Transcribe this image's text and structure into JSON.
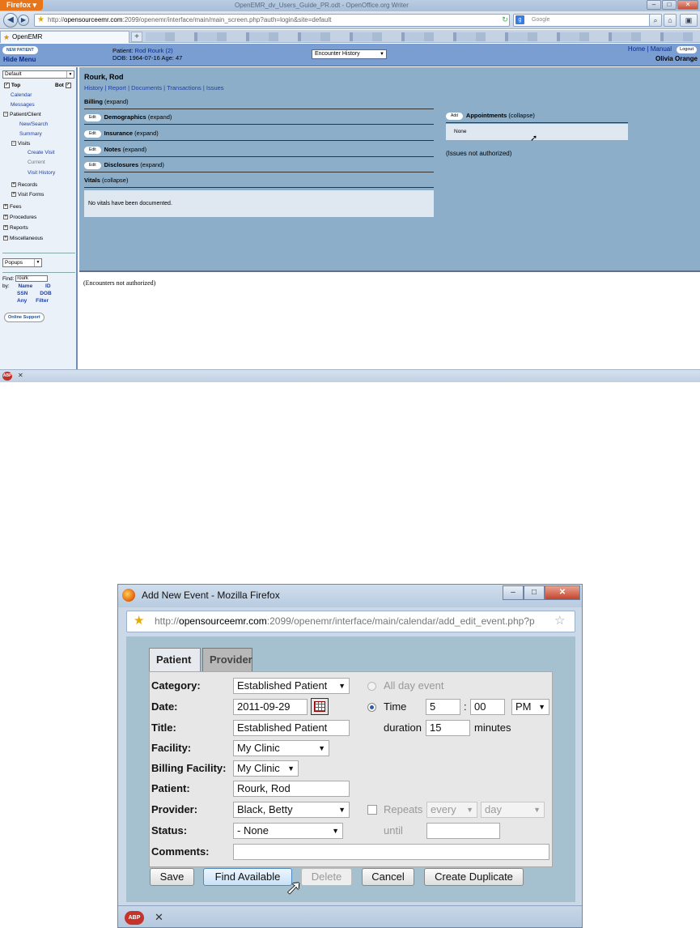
{
  "browser": {
    "menu_label": "Firefox ▾",
    "window_title": "OpenEMR_dv_Users_Guide_PR.odt - OpenOffice.org Writer",
    "url_prefix": "http://",
    "url_host": "opensourceemr.com",
    "url_rest": ":2099/openemr/interface/main/main_screen.php?auth=login&site=default",
    "search_placeholder": "Google",
    "tab_label": "OpenEMR",
    "new_tab": "+"
  },
  "emr_header": {
    "new_patient": "NEW PATIENT",
    "hide_menu": "Hide Menu",
    "patient_label": "Patient:",
    "patient_name": "Rod Rourk (2)",
    "dob_line": "DOB: 1964-07-16 Age: 47",
    "encounter_select": "Encounter History",
    "home": "Home",
    "sep": "|",
    "manual": "Manual",
    "logout": "Logout",
    "user": "Olivia Orange"
  },
  "leftnav": {
    "view_select": "Default",
    "top": "Top",
    "bot": "Bot",
    "calendar": "Calendar",
    "messages": "Messages",
    "patient_client": "Patient/Client",
    "new_search": "New/Search",
    "summary": "Summary",
    "visits": "Visits",
    "create_visit": "Create Visit",
    "current": "Current",
    "visit_history": "Visit History",
    "records": "Records",
    "visit_forms": "Visit Forms",
    "fees": "Fees",
    "procedures": "Procedures",
    "reports": "Reports",
    "miscellaneous": "Miscellaneous",
    "popups": "Popups",
    "find_label": "Find:",
    "find_value": "rourk",
    "by_label": "by:",
    "by_name": "Name",
    "by_id": "ID",
    "by_ssn": "SSN",
    "by_dob": "DOB",
    "by_any": "Any",
    "by_filter": "Filter",
    "online_support": "Online Support"
  },
  "main": {
    "patient_name": "Rourk, Rod",
    "links": [
      "History",
      "Report",
      "Documents",
      "Transactions",
      "Issues"
    ],
    "link_sep": "|",
    "edit": "Edit",
    "billing": "Billing",
    "demographics": "Demographics",
    "insurance": "Insurance",
    "notes": "Notes",
    "disclosures": "Disclosures",
    "vitals": "Vitals",
    "expand": "(expand)",
    "collapse": "(collapse)",
    "vitals_msg": "No vitals have been documented.",
    "add": "Add",
    "appointments": "Appointments",
    "appt_none": "None",
    "issues_msg": "(Issues not authorized)",
    "encounters_msg": "(Encounters not authorized)"
  },
  "popup": {
    "window_title": "Add New Event - Mozilla Firefox",
    "url_prefix": "http://",
    "url_host": "opensourceemr.com",
    "url_rest": ":2099/openemr/interface/main/calendar/add_edit_event.php?p",
    "tabs": {
      "patient": "Patient",
      "provider": "Provider"
    },
    "labels": {
      "category": "Category:",
      "date": "Date:",
      "title": "Title:",
      "facility": "Facility:",
      "billing_facility": "Billing Facility:",
      "patient": "Patient:",
      "provider": "Provider:",
      "status": "Status:",
      "comments": "Comments:"
    },
    "values": {
      "category": "Established Patient",
      "date": "2011-09-29",
      "title": "Established Patient",
      "facility": "My Clinic",
      "billing_facility": "My Clinic",
      "patient": "Rourk, Rod",
      "provider": "Black, Betty",
      "status": "- None",
      "comments": ""
    },
    "all_day": "All day event",
    "time_label": "Time",
    "hour": "5",
    "colon": ":",
    "minute": "00",
    "ampm": "PM",
    "duration_label": "duration",
    "duration": "15",
    "minutes_label": "minutes",
    "repeats_label": "Repeats",
    "repeat_every": "every",
    "repeat_unit": "day",
    "until_label": "until",
    "buttons": {
      "save": "Save",
      "find_available": "Find Available",
      "delete": "Delete",
      "cancel": "Cancel",
      "create_duplicate": "Create Duplicate"
    }
  }
}
